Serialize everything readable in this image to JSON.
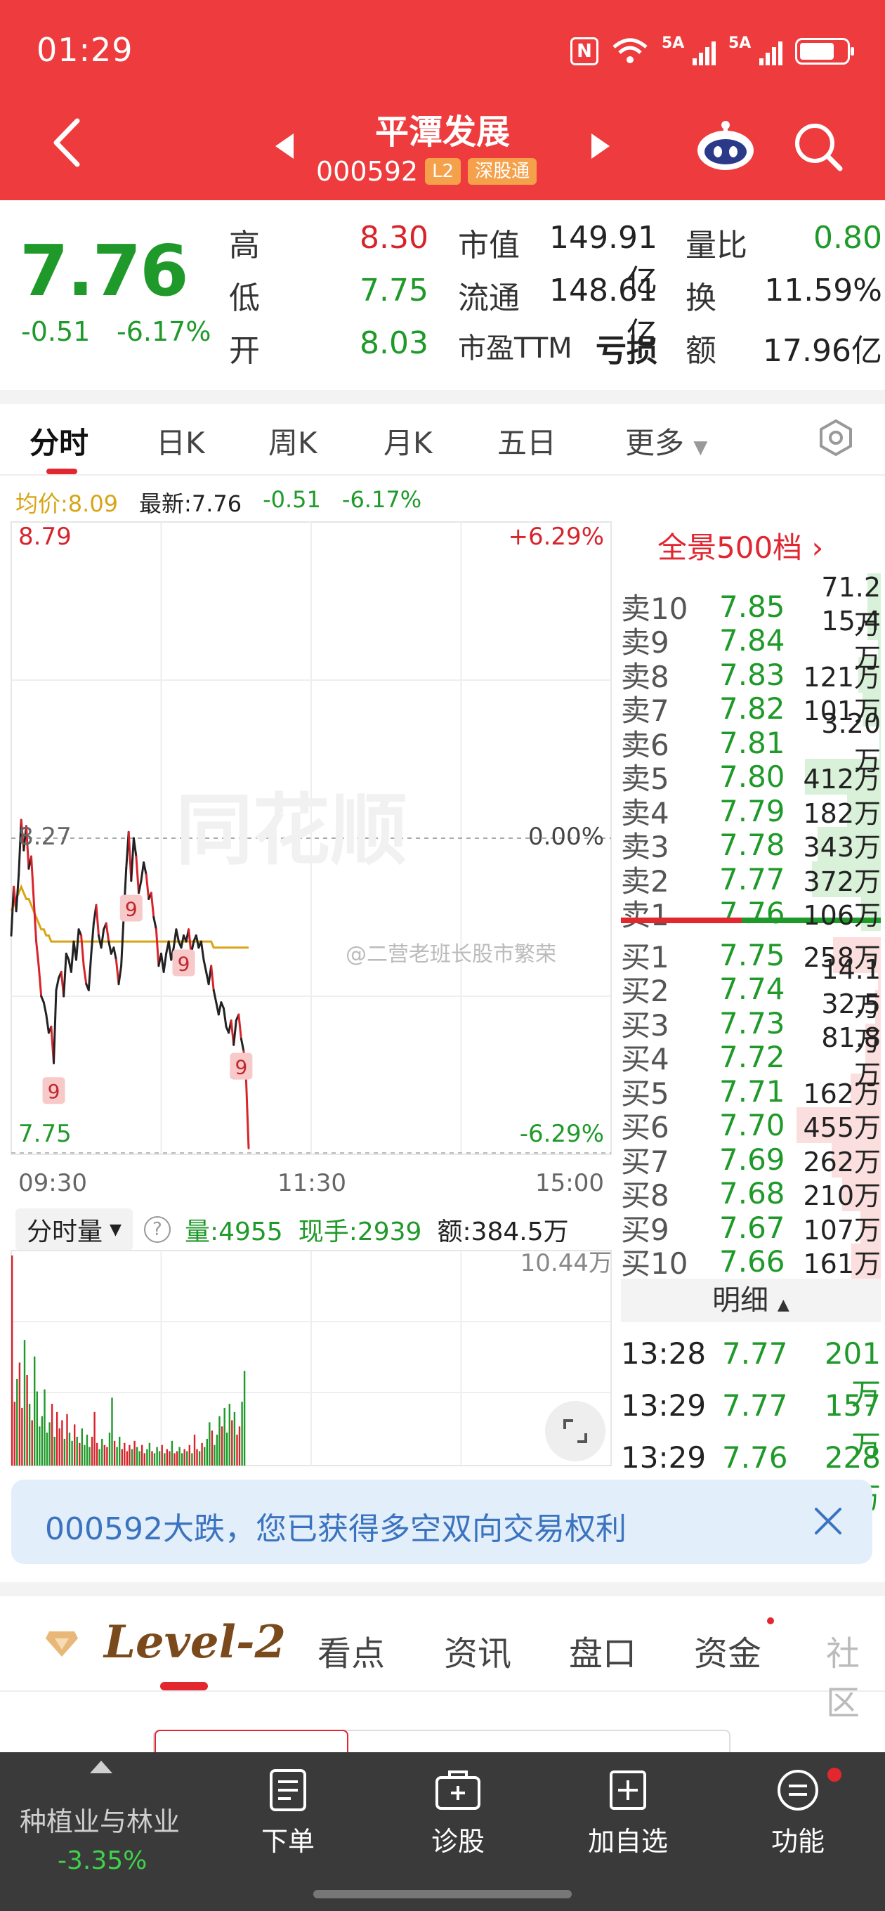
{
  "status": {
    "time": "01:29",
    "net1": "5A",
    "net2": "5A"
  },
  "header": {
    "stock_name": "平潭发展",
    "stock_code": "000592",
    "tag_l2": "L2",
    "tag_sz": "深股通"
  },
  "quote": {
    "price": "7.76",
    "change": "-0.51",
    "change_pct": "-6.17%",
    "high_label": "高",
    "high": "8.30",
    "low_label": "低",
    "low": "7.75",
    "open_label": "开",
    "open": "8.03",
    "mktcap_label": "市值",
    "mktcap": "149.91亿",
    "float_label": "流通",
    "float": "148.61亿",
    "pe_label": "市盈TTM",
    "pe": "亏损",
    "volratio_label": "量比",
    "volratio": "0.80",
    "turnover_label": "换",
    "turnover": "11.59%",
    "amount_label": "额",
    "amount": "17.96亿"
  },
  "tabs": [
    "分时",
    "日K",
    "周K",
    "月K",
    "五日",
    "更多"
  ],
  "info": {
    "avg": "均价:8.09",
    "latest": "最新:7.76",
    "chg": "-0.51",
    "pct": "-6.17%"
  },
  "chart_data": {
    "type": "line",
    "y_top_label": "8.79",
    "y_mid_label": "8.27",
    "y_bottom_label": "7.75",
    "pct_top": "+6.29%",
    "pct_mid": "0.00%",
    "pct_bottom": "-6.29%",
    "x_labels": [
      "09:30",
      "11:30",
      "15:00"
    ],
    "ylim": [
      7.75,
      8.79
    ],
    "prev_close": 8.27,
    "watermark": "同花顺",
    "caption": "@二营老班长股市繁荣",
    "marker_label": "9",
    "series": [
      {
        "values": [
          8.11,
          8.19,
          8.15,
          8.21,
          8.3,
          8.25,
          8.29,
          8.22,
          8.24,
          8.17,
          8.1,
          8.06,
          8.01,
          8.0,
          7.98,
          7.95,
          7.96,
          7.9,
          8.02,
          8.04,
          8.05,
          8.01,
          8.08,
          8.07,
          8.05,
          8.1,
          8.07,
          8.12,
          8.11,
          8.06,
          8.03,
          8.02,
          8.08,
          8.13,
          8.16,
          8.11,
          8.09,
          8.12,
          8.13,
          8.1,
          8.08,
          8.09,
          8.07,
          8.03,
          8.06,
          8.14,
          8.22,
          8.28,
          8.2,
          8.27,
          8.24,
          8.18,
          8.2,
          8.23,
          8.21,
          8.17,
          8.18,
          8.14,
          8.12,
          8.06,
          8.08,
          8.05,
          8.08,
          8.1,
          8.07,
          8.09,
          8.12,
          8.1,
          8.09,
          8.11,
          8.1,
          8.12,
          8.08,
          8.1,
          8.11,
          8.09,
          8.1,
          8.07,
          8.05,
          8.03,
          8.06,
          8.02,
          8.0,
          7.98,
          8.0,
          7.99,
          7.96,
          7.95,
          7.97,
          7.93,
          7.97,
          7.98,
          7.94,
          7.92,
          7.87,
          7.76
        ]
      },
      {
        "values": [
          8.15,
          8.16,
          8.17,
          8.18,
          8.19,
          8.18,
          8.17,
          8.17,
          8.16,
          8.15,
          8.14,
          8.13,
          8.12,
          8.12,
          8.11,
          8.11,
          8.1,
          8.1,
          8.1,
          8.1,
          8.1,
          8.1,
          8.1,
          8.1,
          8.1,
          8.1,
          8.1,
          8.1,
          8.1,
          8.1,
          8.1,
          8.1,
          8.1,
          8.1,
          8.1,
          8.1,
          8.1,
          8.1,
          8.1,
          8.1,
          8.1,
          8.1,
          8.1,
          8.1,
          8.1,
          8.1,
          8.1,
          8.1,
          8.1,
          8.1,
          8.1,
          8.1,
          8.1,
          8.1,
          8.1,
          8.1,
          8.1,
          8.1,
          8.1,
          8.1,
          8.1,
          8.1,
          8.1,
          8.1,
          8.1,
          8.1,
          8.1,
          8.1,
          8.1,
          8.1,
          8.1,
          8.1,
          8.1,
          8.1,
          8.1,
          8.1,
          8.1,
          8.1,
          8.1,
          8.1,
          8.1,
          8.09,
          8.09,
          8.09,
          8.09,
          8.09,
          8.09,
          8.09,
          8.09,
          8.09,
          8.09,
          8.09,
          8.09,
          8.09,
          8.09,
          8.09
        ]
      }
    ],
    "volume": {
      "ylim": [
        0,
        10.44
      ],
      "values": [
        10.2,
        3.1,
        4.2,
        5.0,
        2.8,
        6.1,
        4.4,
        3.0,
        2.2,
        5.3,
        3.6,
        1.9,
        2.4,
        3.7,
        1.6,
        2.1,
        3.0,
        1.4,
        2.6,
        1.8,
        2.2,
        1.3,
        2.5,
        1.6,
        1.2,
        2.0,
        1.4,
        1.1,
        1.8,
        1.0,
        1.5,
        0.9,
        1.4,
        2.6,
        1.1,
        0.8,
        1.3,
        1.0,
        0.9,
        1.6,
        3.3,
        1.2,
        0.9,
        1.4,
        0.8,
        1.1,
        0.7,
        1.0,
        0.8,
        1.2,
        0.9,
        0.7,
        1.0,
        0.6,
        0.8,
        1.1,
        0.7,
        0.6,
        0.9,
        0.7,
        1.0,
        0.6,
        0.8,
        0.7,
        1.2,
        0.6,
        0.7,
        0.9,
        0.6,
        0.8,
        0.7,
        1.0,
        0.6,
        1.5,
        0.8,
        0.7,
        1.1,
        0.9,
        1.3,
        2.1,
        1.7,
        1.0,
        1.5,
        2.4,
        1.9,
        2.8,
        1.6,
        3.0,
        2.2,
        2.6,
        1.5,
        1.9,
        3.1,
        4.6
      ]
    }
  },
  "volume_header": {
    "select": "分时量",
    "help": "?",
    "amount": "量:4955",
    "hand": "现手:2939",
    "money": "额:384.5万",
    "max": "10.44万"
  },
  "order_book": {
    "title": "全景500档",
    "asks": [
      {
        "label": "卖10",
        "price": "7.85",
        "vol": "71.2万",
        "ratio": 0.16
      },
      {
        "label": "卖9",
        "price": "7.84",
        "vol": "15.4万",
        "ratio": 0.03
      },
      {
        "label": "卖8",
        "price": "7.83",
        "vol": "121万",
        "ratio": 0.27
      },
      {
        "label": "卖7",
        "price": "7.82",
        "vol": "101万",
        "ratio": 0.22
      },
      {
        "label": "卖6",
        "price": "7.81",
        "vol": "3.20万",
        "ratio": 0.01
      },
      {
        "label": "卖5",
        "price": "7.80",
        "vol": "412万",
        "ratio": 0.9
      },
      {
        "label": "卖4",
        "price": "7.79",
        "vol": "182万",
        "ratio": 0.4
      },
      {
        "label": "卖3",
        "price": "7.78",
        "vol": "343万",
        "ratio": 0.75
      },
      {
        "label": "卖2",
        "price": "7.77",
        "vol": "372万",
        "ratio": 0.82
      },
      {
        "label": "卖1",
        "price": "7.76",
        "vol": "106万",
        "ratio": 0.23
      }
    ],
    "bids": [
      {
        "label": "买1",
        "price": "7.75",
        "vol": "258万",
        "ratio": 0.57
      },
      {
        "label": "买2",
        "price": "7.74",
        "vol": "14.1万",
        "ratio": 0.03
      },
      {
        "label": "买3",
        "price": "7.73",
        "vol": "32.5万",
        "ratio": 0.07
      },
      {
        "label": "买4",
        "price": "7.72",
        "vol": "81.8万",
        "ratio": 0.18
      },
      {
        "label": "买5",
        "price": "7.71",
        "vol": "162万",
        "ratio": 0.36
      },
      {
        "label": "买6",
        "price": "7.70",
        "vol": "455万",
        "ratio": 1.0
      },
      {
        "label": "买7",
        "price": "7.69",
        "vol": "262万",
        "ratio": 0.58
      },
      {
        "label": "买8",
        "price": "7.68",
        "vol": "210万",
        "ratio": 0.46
      },
      {
        "label": "买9",
        "price": "7.67",
        "vol": "107万",
        "ratio": 0.24
      },
      {
        "label": "买10",
        "price": "7.66",
        "vol": "161万",
        "ratio": 0.35
      }
    ],
    "detail_title": "明细",
    "details": [
      {
        "time": "13:28",
        "price": "7.77",
        "vol": "201万"
      },
      {
        "time": "13:29",
        "price": "7.77",
        "vol": "157万"
      },
      {
        "time": "13:29",
        "price": "7.76",
        "vol": "228万"
      }
    ]
  },
  "banner": {
    "text": "000592大跌，您已获得多空双向交易权利"
  },
  "sub_tabs": {
    "level2": "Level-2",
    "items": [
      "看点",
      "资讯",
      "盘口",
      "资金",
      "社区"
    ]
  },
  "bottom_nav": {
    "industry": "种植业与林业",
    "industry_pct": "-3.35%",
    "items": [
      "下单",
      "诊股",
      "加自选",
      "功能"
    ]
  },
  "colors": {
    "header": "#ee3b3d",
    "up": "#d9232b",
    "down": "#1f9a2a",
    "avg_line": "#d7a516"
  }
}
